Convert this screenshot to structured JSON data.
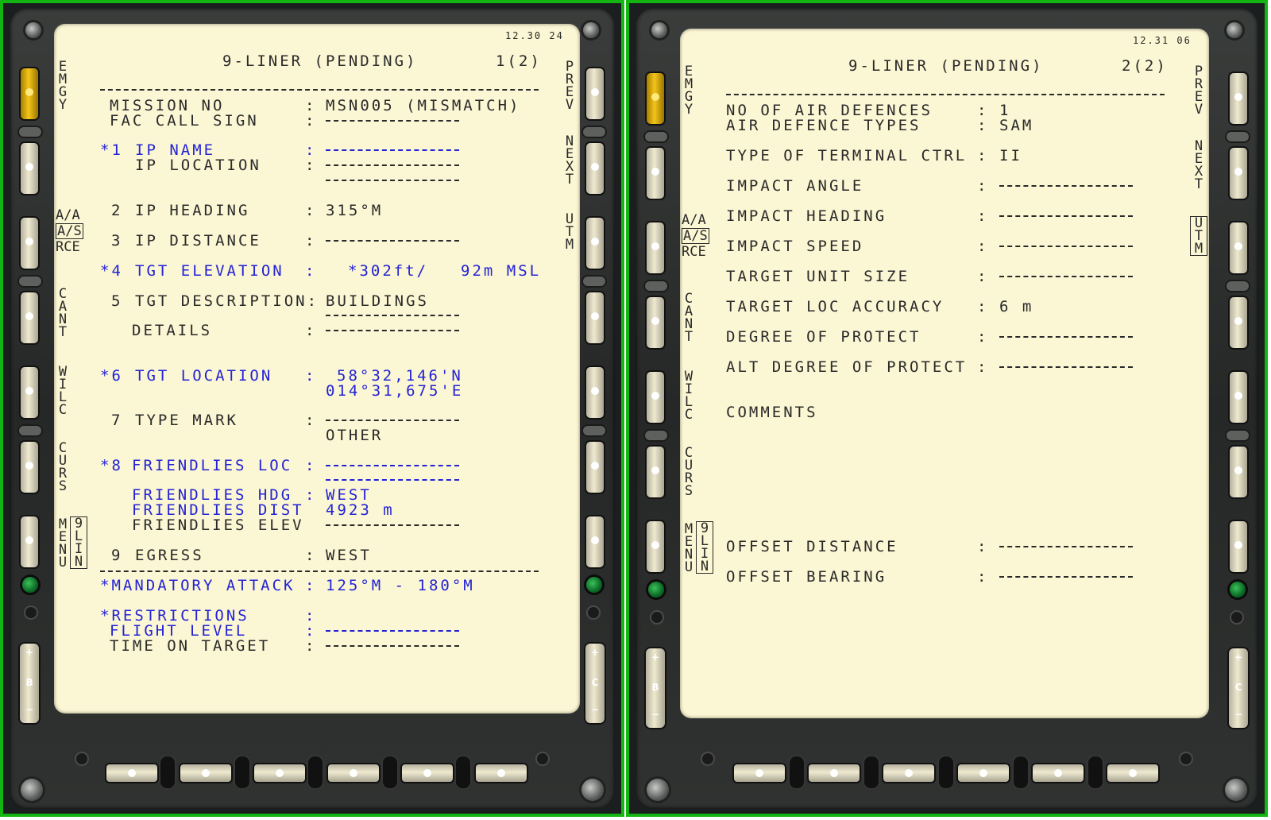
{
  "left": {
    "time": "12.30 24",
    "title": "9-LINER (PENDING)",
    "page": "1(2)",
    "soft_keys_left": {
      "emgy": "EMGY",
      "aa": "A/A",
      "as": "A/S",
      "rce": "RCE",
      "cant": "CANT",
      "wilc": "WILC",
      "curs": "CURS",
      "menu": "MENU",
      "nine_lin": "9LIN"
    },
    "soft_keys_right": {
      "prev": "PREV",
      "next": "NEXT",
      "utm": "UTM"
    },
    "rocker_left": {
      "plus": "+",
      "letter": "B",
      "minus": "−"
    },
    "rocker_right": {
      "plus": "+",
      "letter": "C",
      "minus": "−"
    },
    "rows": {
      "mission_label": "MISSION NO",
      "mission_value": "MSN005 (MISMATCH)",
      "fac_label": "FAC CALL SIGN",
      "ip_name_num": "*1",
      "ip_name_label": "IP NAME",
      "ip_location_label": "IP LOCATION",
      "ip_heading_num": "2",
      "ip_heading_label": "IP HEADING",
      "ip_heading_value": "315°M",
      "ip_distance_num": "3",
      "ip_distance_label": "IP DISTANCE",
      "tgt_elev_num": "*4",
      "tgt_elev_label": "TGT ELEVATION",
      "tgt_elev_value_ft": "*302ft/",
      "tgt_elev_value_m": "92m MSL",
      "tgt_desc_num": "5",
      "tgt_desc_label": "TGT DESCRIPTION:",
      "tgt_desc_value": "BUILDINGS",
      "details_label": "DETAILS",
      "tgt_loc_num": "*6",
      "tgt_loc_label": "TGT LOCATION",
      "tgt_loc_lat": "58°32,146'N",
      "tgt_loc_lon": "014°31,675'E",
      "type_mark_num": "7",
      "type_mark_label": "TYPE MARK",
      "type_mark_value": "OTHER",
      "friendlies_num": "*8",
      "friendlies_label": "FRIENDLIES LOC",
      "friendlies_hdg_label": "FRIENDLIES HDG",
      "friendlies_hdg_value": "WEST",
      "friendlies_dist_label": "FRIENDLIES DIST",
      "friendlies_dist_value": "4923 m",
      "friendlies_elev_label": "FRIENDLIES ELEV",
      "egress_num": "9",
      "egress_label": "EGRESS",
      "egress_value": "WEST",
      "mand_label": "*MANDATORY ATTACK",
      "mand_value": "125°M - 180°M",
      "restrictions_label": "*RESTRICTIONS",
      "flight_level_label": "FLIGHT LEVEL",
      "tot_label": "TIME ON TARGET",
      "colon": ":"
    }
  },
  "right": {
    "time": "12.31 06",
    "title": "9-LINER (PENDING)",
    "page": "2(2)",
    "soft_keys_left": {
      "emgy": "EMGY",
      "aa": "A/A",
      "as": "A/S",
      "rce": "RCE",
      "cant": "CANT",
      "wilc": "WILC",
      "curs": "CURS",
      "menu": "MENU",
      "nine_lin": "9LIN"
    },
    "soft_keys_right": {
      "prev": "PREV",
      "next": "NEXT",
      "utm": "UTM"
    },
    "rocker_left": {
      "plus": "+",
      "letter": "B",
      "minus": "−"
    },
    "rocker_right": {
      "plus": "+",
      "letter": "C",
      "minus": "−"
    },
    "rows": {
      "no_ad_label": "NO OF AIR DEFENCES",
      "no_ad_value": "1",
      "ad_types_label": "AIR DEFENCE TYPES",
      "ad_types_value": "SAM",
      "term_ctrl_label": "TYPE OF TERMINAL CTRL",
      "term_ctrl_value": "II",
      "impact_angle_label": "IMPACT ANGLE",
      "impact_heading_label": "IMPACT HEADING",
      "impact_speed_label": "IMPACT SPEED",
      "unit_size_label": "TARGET UNIT SIZE",
      "loc_acc_label": "TARGET LOC ACCURACY",
      "loc_acc_value": "6 m",
      "deg_protect_label": "DEGREE OF PROTECT",
      "alt_deg_label": "ALT DEGREE OF PROTECT",
      "comments_label": "COMMENTS",
      "offset_dist_label": "OFFSET DISTANCE",
      "offset_bearing_label": "OFFSET BEARING",
      "colon": ":"
    }
  },
  "colors": {
    "frame": "#12b512",
    "screen": "#fbf6d3",
    "text": "#2a2a2a",
    "highlight": "#2323d6",
    "emgy": "#f4c51b"
  }
}
